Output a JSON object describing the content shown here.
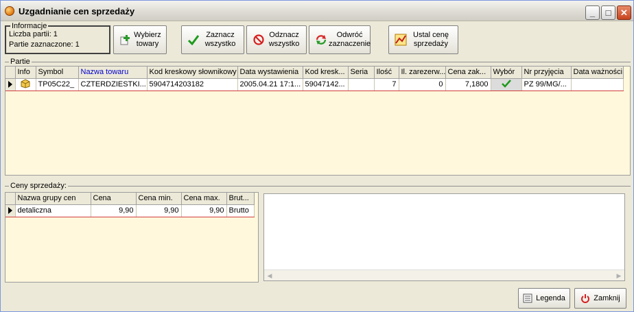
{
  "window": {
    "title": "Uzgadnianie cen sprzedaży"
  },
  "info": {
    "legend": "Informacje",
    "lines": [
      "Liczba partii: 1",
      "Partie zaznaczone:  1"
    ]
  },
  "toolbar": {
    "wybierz": "Wybierz\ntowary",
    "zaznacz": "Zaznacz\nwszystko",
    "odznacz": "Odznacz\nwszystko",
    "odwroc": "Odwróć\nzaznaczenie",
    "ustal": "Ustal cenę\nsprzedaży"
  },
  "partie": {
    "label": "Partie",
    "columns": [
      "Info",
      "Symbol",
      "Nazwa towaru",
      "Kod kreskowy słownikowy",
      "Data wystawienia",
      "Kod kresk...",
      "Seria",
      "Ilość",
      "Il. zarezerw...",
      "Cena zak...",
      "Wybór",
      "Nr przyjęcia",
      "Data ważności"
    ],
    "rows": [
      [
        "",
        "TP05C22_",
        "CZTERDZIESTKI...",
        "5904714203182",
        "2005.04.21 17:1...",
        "59047142...",
        "",
        "7",
        "0",
        "7,1800",
        "",
        "PZ 99/MG/...",
        ""
      ]
    ]
  },
  "ceny": {
    "label": "Ceny sprzedaży:",
    "columns": [
      "Nazwa grupy cen",
      "Cena",
      "Cena min.",
      "Cena max.",
      "Brut..."
    ],
    "rows": [
      [
        "detaliczna",
        "9,90",
        "9,90",
        "9,90",
        "Brutto"
      ]
    ]
  },
  "buttons": {
    "legenda": "Legenda",
    "zamknij": "Zamknij"
  },
  "colors": {
    "grid_bg": "#fff8dc",
    "selection": "#d23c3c",
    "sorted_header": "#0000cc"
  }
}
